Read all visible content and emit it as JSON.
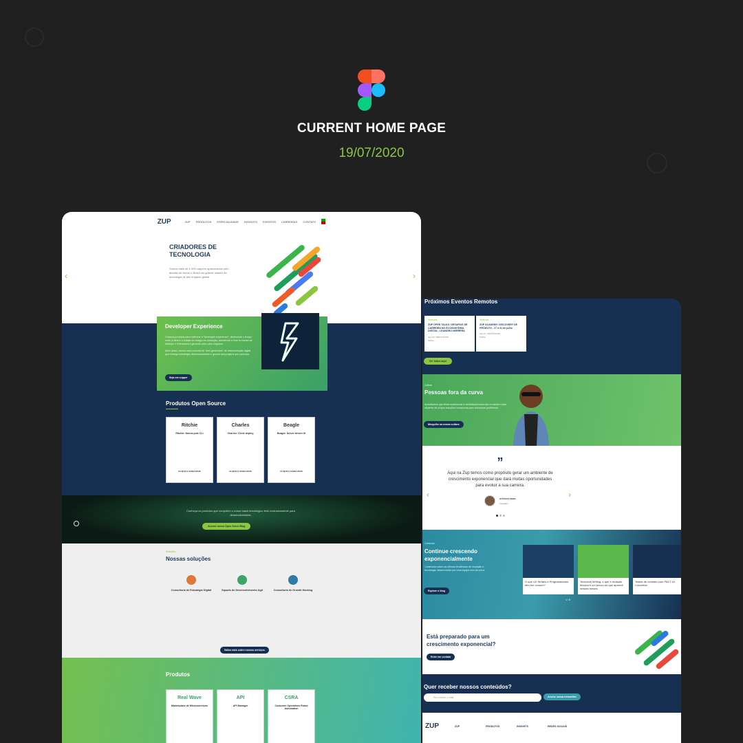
{
  "header": {
    "title": "CURRENT HOME PAGE",
    "date": "19/07/2020"
  },
  "colors": {
    "background": "#202020",
    "accent_green": "#8cc63f",
    "navy": "#173052"
  },
  "left_page": {
    "logo": "ZUP",
    "nav": [
      "ZUP",
      "PRODUTOS",
      "ESPECIALIDADE",
      "INSIGHTS",
      "EVENTOS",
      "CARREIRAS",
      "CONTATO"
    ],
    "hero": {
      "title": "CRIADORES DE TECNOLOGIA",
      "text": "Somos mais de 1.000 zuppers apaixonados pelo desafio de tornar o Brasil um grande criador de tecnologia de alto impacto global."
    },
    "dev_experience": {
      "title": "Developer Experience",
      "text1": "Criamos produtos para melhorar a \"developer experience\", diminuindo o tempo entre a ideia e a subida do código em produção, atendendo o time to market de startups e enterprises e gerando valor para negócios.",
      "text2": "Além disso, somos uma consultoria \"next generation\" de transformação digital, que entrega estratégia, desenvolvimento e growth dos projetos que participa.",
      "button": "Seja um zupper"
    },
    "open_source": {
      "title": "Produtos Open Source",
      "cards": [
        {
          "name": "Ritchie",
          "subtitle": "Ritchie: Nunca pule CLI",
          "link": "CLIQUE E SAIBA MAIS"
        },
        {
          "name": "Charles",
          "subtitle": "Charles: Circle deploy",
          "link": "CLIQUE E SAIBA MAIS"
        },
        {
          "name": "Beagle",
          "subtitle": "Beagle: Server driven UI",
          "link": "CLIQUE E SAIBA MAIS"
        }
      ]
    },
    "blog": {
      "text": "Conheça os produtos que compõem o nosso stack tecnológico feito exclusivamente para desenvolvedores.",
      "button": "Acesse nosso Open Sorce Blog"
    },
    "solutions": {
      "label": "Soluções",
      "title": "Nossas soluções",
      "items": [
        {
          "title": "Consultoria de Estratégia Digital"
        },
        {
          "title": "Squads de Desenvolvimento Agil"
        },
        {
          "title": "Consultoria de Growth Hacking"
        }
      ],
      "button": "Saiba mais sobre nossos serviços"
    },
    "products": {
      "title": "Produtos",
      "cards": [
        {
          "name": "Real Wave",
          "title": "Marketplace de Microsserviços"
        },
        {
          "name": "API",
          "title": "API Manager"
        },
        {
          "name": "CSRA",
          "title": "Customer Operations Robot Automation"
        }
      ]
    }
  },
  "right_page": {
    "events": {
      "title": "Próximos Eventos Remotos",
      "items": [
        {
          "tag": "Webinars",
          "title": "ZUP OPEN TALKS: DESAFIOS DE CARREIRA NO ECOSSISTEMA DIGITAL - LEANDRO HERRERA",
          "date": "July 22, 2020 6:00 PM",
          "place": "Online"
        },
        {
          "tag": "Webinars",
          "title": "ZUP ACADEMY: DISCOVERY DE PRODUTO - 27 a 31 de julho",
          "date": "July 27, 2020 8:00 PM",
          "place": "Online"
        }
      ],
      "button": "Ver todos aqui"
    },
    "people": {
      "label": "Cultura",
      "title": "Pessoas fora da curva",
      "text": "Acreditamos que times autônomos e multidisciplinares são a maneira mais eficiente de propor soluções inovadoras para solucionar problemas.",
      "button": "Mergulhe na nossa cultura"
    },
    "quote": {
      "mark": "”",
      "text": "Aqui na Zup temos como propósito gerar um ambiente de crescimento exponencial que dará muitas oportunidades para evoluir a sua carreira.",
      "author": "GUSTAVO DEBS",
      "role": "Fundador"
    },
    "growth": {
      "label": "Conteúdo",
      "title": "Continue crescendo exponencialmente",
      "text": "Conteúdos sobre as últimas tendências de inovação e tecnologia, desenvolvido por uma equipe fora da curva.",
      "button": "Explore o blog",
      "posts": [
        {
          "title": "O que UX Writers e Programadores têm em comum?"
        },
        {
          "title": "Technical Writing: o que é redação técnica e um pouco do que aprendi nesses meses"
        },
        {
          "title": "Testes de contrato com PACT #1 Conceitos"
        }
      ],
      "pager": "1 / 6"
    },
    "ready": {
      "title": "Está preparado para um crescimento exponencial?",
      "button": "Entre em contato"
    },
    "newsletter": {
      "title": "Quer receber nossos conteúdos?",
      "placeholder": "Seu melhor e-mail",
      "button": "Assine nossa newsletter"
    },
    "footer": {
      "logo": "ZUP",
      "cols": [
        "ZUP",
        "PRODUTOS",
        "INSIGHTS",
        "REDES SOCIAIS"
      ]
    }
  }
}
